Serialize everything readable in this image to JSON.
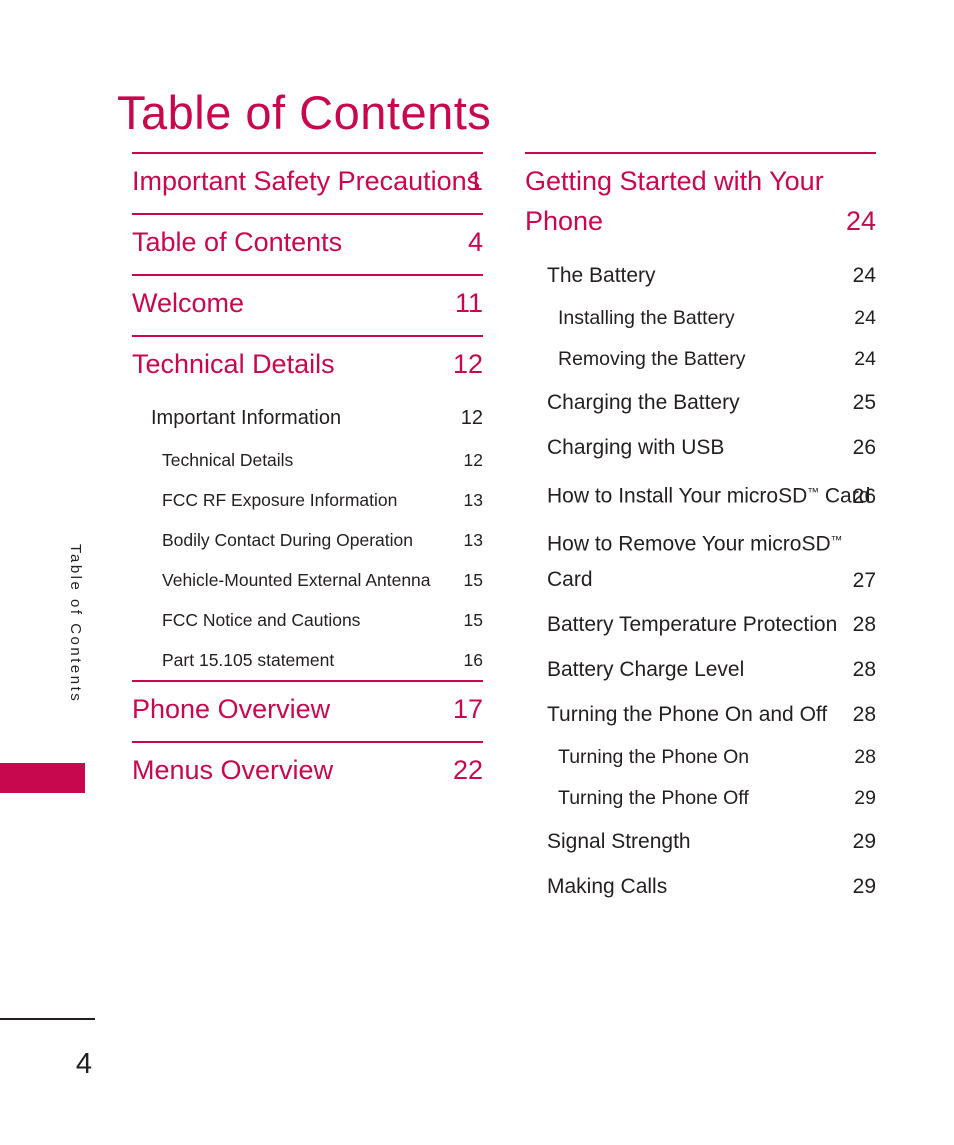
{
  "page": {
    "title": "Table of Contents",
    "side_tab_label": "Table of Contents",
    "page_number": "4"
  },
  "columns": {
    "left": [
      {
        "kind": "rule"
      },
      {
        "kind": "entry",
        "level": 0,
        "title": "Important Safety Precautions",
        "page": "1",
        "wrap": true
      },
      {
        "kind": "rule"
      },
      {
        "kind": "entry",
        "level": 0,
        "title": "Table of Contents",
        "page": "4"
      },
      {
        "kind": "rule"
      },
      {
        "kind": "entry",
        "level": 0,
        "title": "Welcome",
        "page": "11"
      },
      {
        "kind": "rule"
      },
      {
        "kind": "entry",
        "level": 0,
        "title": "Technical Details",
        "page": "12"
      },
      {
        "kind": "entry",
        "level": 1,
        "title": "Important Information",
        "page": "12"
      },
      {
        "kind": "entry",
        "level": 2,
        "title": "Technical Details",
        "page": "12"
      },
      {
        "kind": "entry",
        "level": 2,
        "title": "FCC RF Exposure Information",
        "page": "13"
      },
      {
        "kind": "entry",
        "level": 2,
        "title": "Bodily Contact During Operation",
        "page": "13"
      },
      {
        "kind": "entry",
        "level": 2,
        "title": "Vehicle-Mounted External Antenna",
        "page": "15"
      },
      {
        "kind": "entry",
        "level": 2,
        "title": "FCC Notice and Cautions",
        "page": "15"
      },
      {
        "kind": "entry",
        "level": 2,
        "title": "Part 15.105 statement",
        "page": "16"
      },
      {
        "kind": "rule"
      },
      {
        "kind": "entry",
        "level": 0,
        "title": "Phone Overview",
        "page": "17"
      },
      {
        "kind": "rule"
      },
      {
        "kind": "entry",
        "level": 0,
        "title": "Menus Overview",
        "page": "22"
      }
    ],
    "right": [
      {
        "kind": "rule"
      },
      {
        "kind": "entry",
        "level": 0,
        "title": "Getting Started with Your Phone",
        "page": "24",
        "wrap": true
      },
      {
        "kind": "entry",
        "level": 1,
        "title": "The Battery",
        "page": "24"
      },
      {
        "kind": "entry",
        "level": 2,
        "title": "Installing the Battery",
        "page": "24"
      },
      {
        "kind": "entry",
        "level": 2,
        "title": "Removing the Battery",
        "page": "24"
      },
      {
        "kind": "entry",
        "level": 1,
        "title": "Charging the Battery",
        "page": "25"
      },
      {
        "kind": "entry",
        "level": 1,
        "title": "Charging with USB",
        "page": "26"
      },
      {
        "kind": "entry",
        "level": 1,
        "title": "How to Install Your microSD™ Card",
        "page": "26",
        "wrap": true
      },
      {
        "kind": "entry",
        "level": 1,
        "title": "How to Remove Your microSD™ Card",
        "page": "27",
        "wrap": true
      },
      {
        "kind": "entry",
        "level": 1,
        "title": "Battery Temperature Protection",
        "page": "28"
      },
      {
        "kind": "entry",
        "level": 1,
        "title": "Battery Charge Level",
        "page": "28"
      },
      {
        "kind": "entry",
        "level": 1,
        "title": "Turning the Phone On and Off",
        "page": "28"
      },
      {
        "kind": "entry",
        "level": 2,
        "title": "Turning the Phone On",
        "page": "28"
      },
      {
        "kind": "entry",
        "level": 2,
        "title": "Turning the Phone Off",
        "page": "29"
      },
      {
        "kind": "entry",
        "level": 1,
        "title": "Signal Strength",
        "page": "29"
      },
      {
        "kind": "entry",
        "level": 1,
        "title": "Making Calls",
        "page": "29"
      }
    ]
  },
  "colors": {
    "accent": "#c7084f",
    "text": "#231f20"
  }
}
